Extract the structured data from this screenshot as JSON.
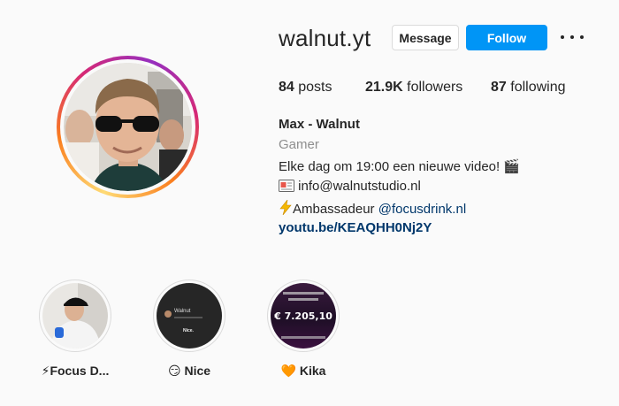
{
  "profile": {
    "username": "walnut.yt",
    "buttons": {
      "message": "Message",
      "follow": "Follow"
    },
    "stats": {
      "posts_count": "84",
      "posts_label": "posts",
      "followers_count": "21.9K",
      "followers_label": "followers",
      "following_count": "87",
      "following_label": "following"
    },
    "bio": {
      "name": "Max - Walnut",
      "category": "Gamer",
      "line1": "Elke dag om 19:00 een nieuwe video! 🎬",
      "email": "info@walnutstudio.nl",
      "ambassador_prefix": "Ambassadeur ",
      "mention": "@focusdrink.nl",
      "link": "youtu.be/KEAQHH0Nj2Y"
    }
  },
  "highlights": [
    {
      "label": "⚡Focus D...",
      "icon": "photo-of-person"
    },
    {
      "label": "😏 Nice",
      "icon": "dark-story",
      "inner_name": "Walnut",
      "inner_text": "Nice."
    },
    {
      "label": "🧡 Kika",
      "icon": "donation-story",
      "amount": "€ 7.205,10"
    }
  ],
  "colors": {
    "follow_button": "#0095f6",
    "link_text": "#00376b",
    "secondary_text": "#8e8e8e"
  }
}
